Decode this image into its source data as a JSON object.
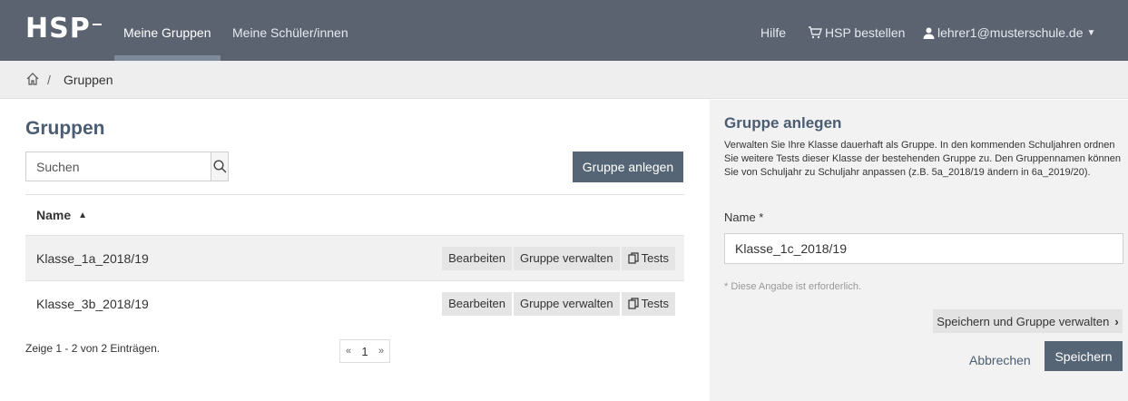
{
  "navbar": {
    "logo": "HSP",
    "links": [
      {
        "label": "Meine Gruppen",
        "active": true
      },
      {
        "label": "Meine Schüler/innen",
        "active": false
      }
    ],
    "help": "Hilfe",
    "order": "HSP bestellen",
    "user": "lehrer1@musterschule.de",
    "bg_color": "#5b6370"
  },
  "breadcrumb": {
    "separator": "/",
    "current": "Gruppen"
  },
  "groups": {
    "title": "Gruppen",
    "search_placeholder": "Suchen",
    "create_button": "Gruppe anlegen",
    "column_name": "Name",
    "rows": [
      {
        "name": "Klasse_1a_2018/19"
      },
      {
        "name": "Klasse_3b_2018/19"
      }
    ],
    "actions": {
      "edit": "Bearbeiten",
      "manage": "Gruppe verwalten",
      "tests": "Tests"
    },
    "summary": "Zeige 1 - 2 von 2 Einträgen.",
    "pager": {
      "prev": "«",
      "current": "1",
      "next": "»"
    }
  },
  "form": {
    "title": "Gruppe anlegen",
    "description": "Verwalten Sie Ihre Klasse dauerhaft als Gruppe. In den kommenden Schuljahren ordnen Sie weitere Tests dieser Klasse der bestehenden Gruppe zu. Den Gruppennamen können Sie von Schuljahr zu Schuljahr anpassen (z.B. 5a_2018/19 ändern in 6a_2019/20).",
    "name_label": "Name *",
    "name_value": "Klasse_1c_2018/19",
    "hint": "* Diese Angabe ist erforderlich.",
    "save_manage": "Speichern und Gruppe verwalten",
    "cancel": "Abbrechen",
    "save": "Speichern",
    "accent_color": "#566576"
  }
}
